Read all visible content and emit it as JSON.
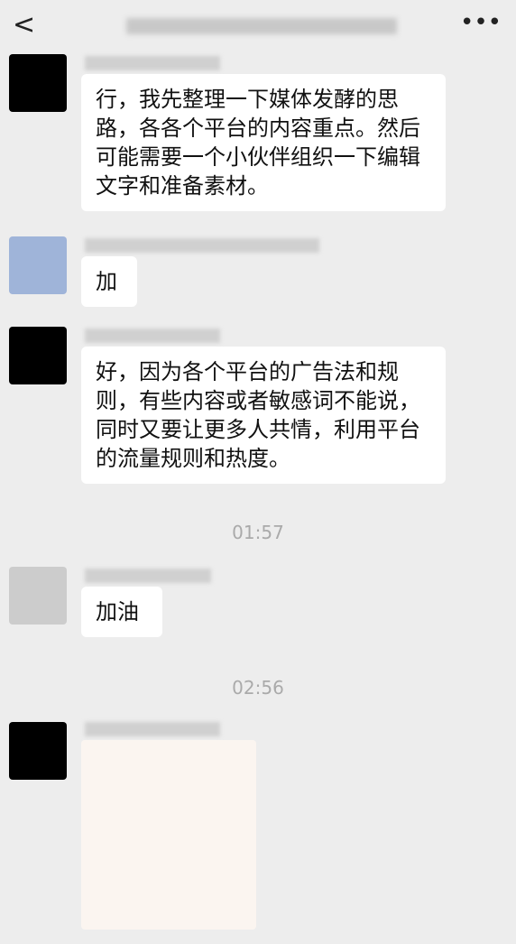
{
  "m1": "行，我先整理一下媒体发酵的思路，各各个平台的内容重点。然后可能需要一个小伙伴组织一下编辑文字和准备素材。",
  "m2": "加",
  "m3": "好，因为各个平台的广告法和规则，有些内容或者敏感词不能说，同时又要让更多人共情，利用平台的流量规则和热度。",
  "t1": "01:57",
  "m4": "加油",
  "t2": "02:56",
  "back": "<",
  "more": "•••"
}
